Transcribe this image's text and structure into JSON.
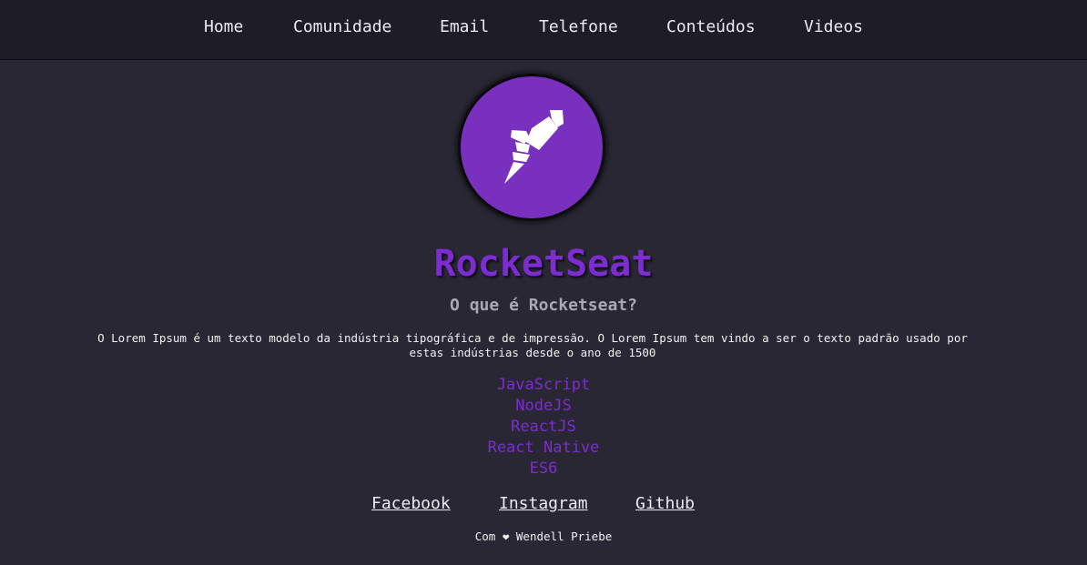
{
  "nav": {
    "items": [
      {
        "label": "Home"
      },
      {
        "label": "Comunidade"
      },
      {
        "label": "Email"
      },
      {
        "label": "Telefone"
      },
      {
        "label": "Conteúdos"
      },
      {
        "label": "Videos"
      }
    ]
  },
  "logo": {
    "icon": "rocket-icon"
  },
  "hero": {
    "title": "RocketSeat",
    "subtitle": "O que é Rocketseat?",
    "description": "O Lorem Ipsum é um texto modelo da indústria tipográfica e de impressão. O Lorem Ipsum tem vindo a ser o texto padrão usado por estas indústrias desde o ano de 1500"
  },
  "technologies": [
    "JavaScript",
    "NodeJS",
    "ReactJS",
    "React Native",
    "ES6"
  ],
  "social": {
    "links": [
      {
        "label": "Facebook"
      },
      {
        "label": "Instagram"
      },
      {
        "label": "Github"
      }
    ]
  },
  "footer": {
    "text": "Com ❤ Wendell Priebe"
  },
  "colors": {
    "background": "#282733",
    "navbar": "#1e1c27",
    "accent": "#7c2cd0",
    "logo_circle": "#7a30bf"
  }
}
